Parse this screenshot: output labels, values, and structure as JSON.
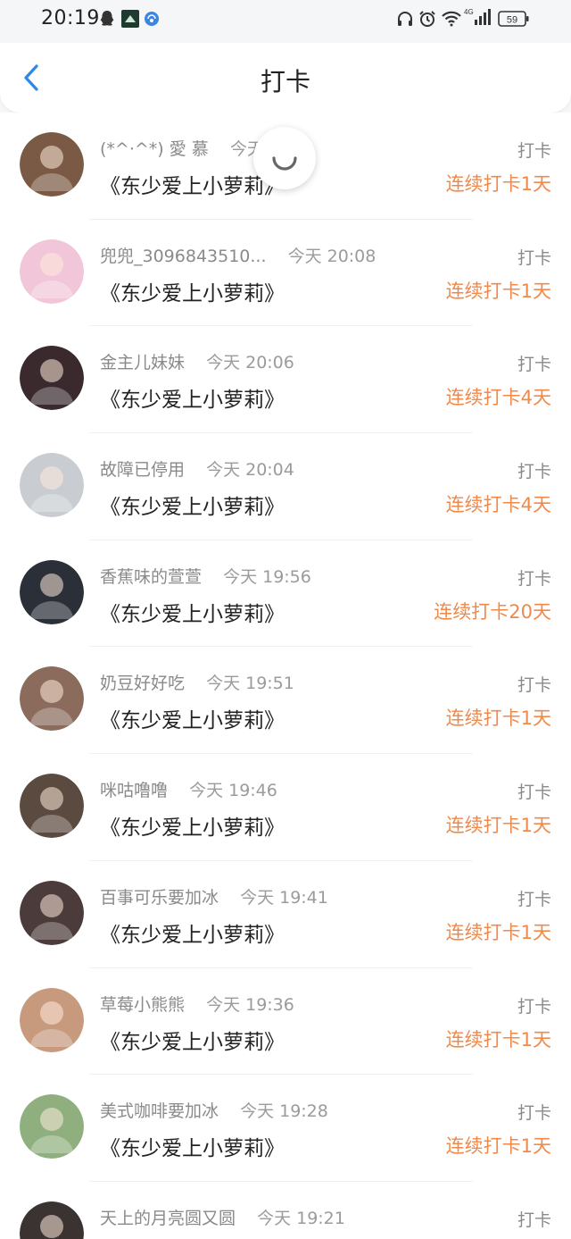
{
  "status_bar": {
    "time": "20:19",
    "battery": "59",
    "network": "4G",
    "left_icons": [
      "qq-icon",
      "app-icon",
      "browser-icon"
    ],
    "right_icons": [
      "headphones-icon",
      "alarm-icon",
      "wifi-icon",
      "signal-icon",
      "battery-icon"
    ]
  },
  "header": {
    "title": "打卡"
  },
  "rows": [
    {
      "name": "(*^·^*) 愛 慕",
      "time": "今天",
      "book": "《东少爱上小萝莉》",
      "tag": "打卡",
      "streak": "连续打卡1天",
      "avatar_color": "#7a5a44"
    },
    {
      "name": "兜兜_3096843510...",
      "time": "今天 20:08",
      "book": "《东少爱上小萝莉》",
      "tag": "打卡",
      "streak": "连续打卡1天",
      "avatar_color": "#f1c6d8"
    },
    {
      "name": "金主儿妹妹",
      "time": "今天 20:06",
      "book": "《东少爱上小萝莉》",
      "tag": "打卡",
      "streak": "连续打卡4天",
      "avatar_color": "#3a2a2e"
    },
    {
      "name": "故障已停用",
      "time": "今天 20:04",
      "book": "《东少爱上小萝莉》",
      "tag": "打卡",
      "streak": "连续打卡4天",
      "avatar_color": "#c9cdd2"
    },
    {
      "name": "香蕉味的萱萱",
      "time": "今天 19:56",
      "book": "《东少爱上小萝莉》",
      "tag": "打卡",
      "streak": "连续打卡20天",
      "avatar_color": "#2b2f38"
    },
    {
      "name": "奶豆好好吃",
      "time": "今天 19:51",
      "book": "《东少爱上小萝莉》",
      "tag": "打卡",
      "streak": "连续打卡1天",
      "avatar_color": "#8a6b5c"
    },
    {
      "name": "咪咕噜噜",
      "time": "今天 19:46",
      "book": "《东少爱上小萝莉》",
      "tag": "打卡",
      "streak": "连续打卡1天",
      "avatar_color": "#5a4a3f"
    },
    {
      "name": "百事可乐要加冰",
      "time": "今天 19:41",
      "book": "《东少爱上小萝莉》",
      "tag": "打卡",
      "streak": "连续打卡1天",
      "avatar_color": "#4b3b3a"
    },
    {
      "name": "草莓小熊熊",
      "time": "今天 19:36",
      "book": "《东少爱上小萝莉》",
      "tag": "打卡",
      "streak": "连续打卡1天",
      "avatar_color": "#c79a7e"
    },
    {
      "name": "美式咖啡要加冰",
      "time": "今天 19:28",
      "book": "《东少爱上小萝莉》",
      "tag": "打卡",
      "streak": "连续打卡1天",
      "avatar_color": "#8fb07e"
    },
    {
      "name": "天上的月亮圆又圆",
      "time": "今天 19:21",
      "book": "",
      "tag": "打卡",
      "streak": "",
      "avatar_color": "#3b3331"
    }
  ],
  "colors": {
    "accent": "#2c8ae6",
    "streak": "#f0894a",
    "muted": "#8a8a8a"
  }
}
